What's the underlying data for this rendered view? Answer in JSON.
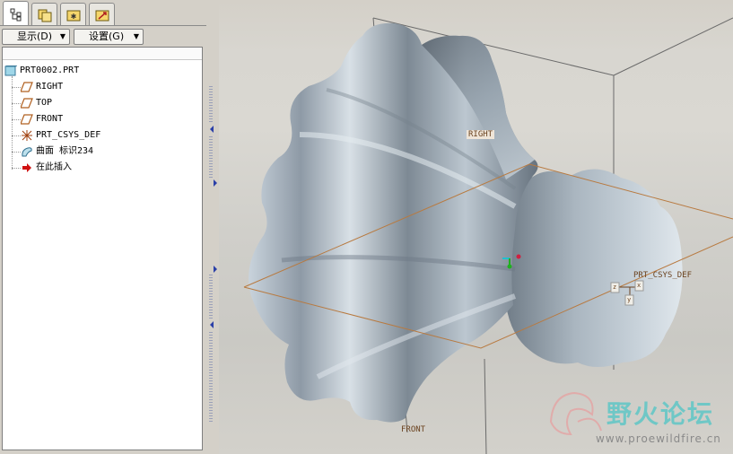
{
  "tabs": [
    {
      "name": "model-tree"
    },
    {
      "name": "folder-browser"
    },
    {
      "name": "favorites"
    },
    {
      "name": "connections"
    }
  ],
  "menus": {
    "display_label": "显示(D)",
    "settings_label": "设置(G)"
  },
  "tree": {
    "root": "PRT0002.PRT",
    "items": [
      {
        "label": "RIGHT",
        "icon": "datum-plane-icon"
      },
      {
        "label": "TOP",
        "icon": "datum-plane-icon"
      },
      {
        "label": "FRONT",
        "icon": "datum-plane-icon"
      },
      {
        "label": "PRT_CSYS_DEF",
        "icon": "coordinate-system-icon"
      },
      {
        "label": "曲面 标识234",
        "icon": "surface-feature-icon"
      },
      {
        "label": "在此插入",
        "icon": "insert-here-arrow-icon"
      }
    ]
  },
  "viewport": {
    "datum_labels": {
      "right": "RIGHT",
      "front": "FRONT",
      "csys": "PRT_CSYS_DEF",
      "axis_z": "z",
      "axis_x": "x",
      "axis_y": "y"
    },
    "watermark": {
      "title": "野火论坛",
      "url": "www.proewildfire.cn"
    }
  },
  "colors": {
    "datum_plane_edge": "#b87a40",
    "datum_plane_dark": "#6a6a6a",
    "surface_mid": "#a4b0bc",
    "insert_arrow": "#d01010"
  }
}
